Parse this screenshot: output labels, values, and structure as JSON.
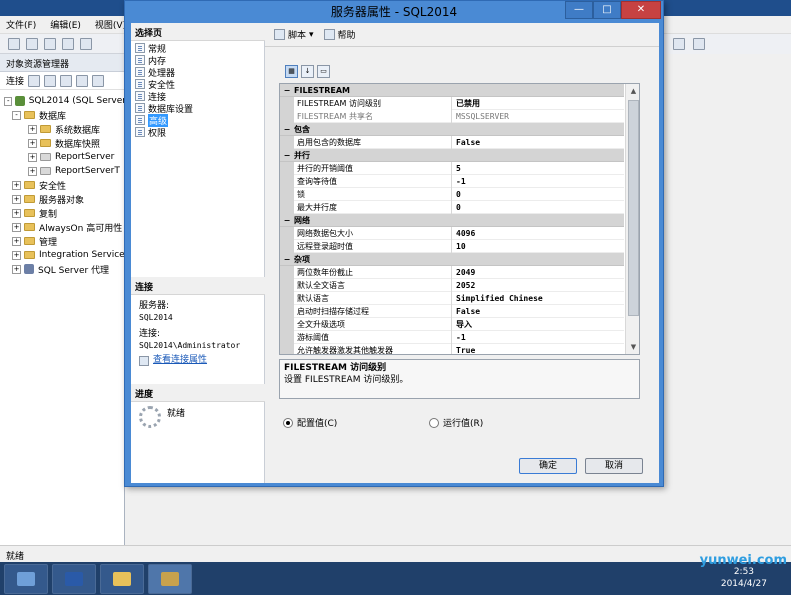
{
  "ssms": {
    "menu": [
      "文件(F)",
      "编辑(E)",
      "视图(V)"
    ],
    "explorer_title": "对象资源管理器",
    "connect_label": "连接",
    "tree": [
      {
        "label": "SQL2014 (SQL Server",
        "kind": "server",
        "expander": "-",
        "indent": 0
      },
      {
        "label": "数据库",
        "kind": "folder",
        "expander": "-",
        "indent": 1
      },
      {
        "label": "系统数据库",
        "kind": "folder",
        "expander": "+",
        "indent": 2
      },
      {
        "label": "数据库快照",
        "kind": "folder",
        "expander": "+",
        "indent": 2
      },
      {
        "label": "ReportServer",
        "kind": "db",
        "expander": "+",
        "indent": 2
      },
      {
        "label": "ReportServerT",
        "kind": "db",
        "expander": "+",
        "indent": 2
      },
      {
        "label": "安全性",
        "kind": "folder",
        "expander": "+",
        "indent": 1
      },
      {
        "label": "服务器对象",
        "kind": "folder",
        "expander": "+",
        "indent": 1
      },
      {
        "label": "复制",
        "kind": "folder",
        "expander": "+",
        "indent": 1
      },
      {
        "label": "AlwaysOn 高可用性",
        "kind": "folder",
        "expander": "+",
        "indent": 1
      },
      {
        "label": "管理",
        "kind": "folder",
        "expander": "+",
        "indent": 1
      },
      {
        "label": "Integration Service",
        "kind": "folder",
        "expander": "+",
        "indent": 1
      },
      {
        "label": "SQL Server 代理",
        "kind": "agent",
        "expander": "+",
        "indent": 1
      }
    ],
    "status": "就绪",
    "clock_time": "2:53",
    "clock_date": "2014/4/27",
    "watermark": "yunwei.com"
  },
  "dialog": {
    "title": "服务器属性 - SQL2014",
    "select_page_header": "选择页",
    "pages": [
      "常规",
      "内存",
      "处理器",
      "安全性",
      "连接",
      "数据库设置",
      "高级",
      "权限"
    ],
    "selected_page_index": 6,
    "connection_header": "连接",
    "server_label": "服务器:",
    "server_value": "SQL2014",
    "connection_label": "连接:",
    "connection_value": "SQL2014\\Administrator",
    "view_conn_props": "查看连接属性",
    "progress_header": "进度",
    "progress_status": "就绪",
    "toolbar": {
      "script": "脚本",
      "help": "帮助"
    },
    "categories": [
      {
        "name": "FILESTREAM",
        "rows": [
          {
            "name": "FILESTREAM 访问级别",
            "value": "已禁用",
            "readonly": false
          },
          {
            "name": "FILESTREAM 共享名",
            "value": "MSSQLSERVER",
            "readonly": true
          }
        ]
      },
      {
        "name": "包含",
        "rows": [
          {
            "name": "启用包含的数据库",
            "value": "False",
            "readonly": false
          }
        ]
      },
      {
        "name": "并行",
        "rows": [
          {
            "name": "并行的开销阈值",
            "value": "5",
            "readonly": false
          },
          {
            "name": "查询等待值",
            "value": "-1",
            "readonly": false
          },
          {
            "name": "锁",
            "value": "0",
            "readonly": false
          },
          {
            "name": "最大并行度",
            "value": "0",
            "readonly": false
          }
        ]
      },
      {
        "name": "网络",
        "rows": [
          {
            "name": "网络数据包大小",
            "value": "4096",
            "readonly": false
          },
          {
            "name": "远程登录超时值",
            "value": "10",
            "readonly": false
          }
        ]
      },
      {
        "name": "杂项",
        "rows": [
          {
            "name": "两位数年份截止",
            "value": "2049",
            "readonly": false
          },
          {
            "name": "默认全文语言",
            "value": "2052",
            "readonly": false
          },
          {
            "name": "默认语言",
            "value": "Simplified Chinese",
            "readonly": false
          },
          {
            "name": "启动时扫描存储过程",
            "value": "False",
            "readonly": false
          },
          {
            "name": "全文升级选项",
            "value": "导入",
            "readonly": false
          },
          {
            "name": "游标阈值",
            "value": "-1",
            "readonly": false
          },
          {
            "name": "允许触发器激发其他触发器",
            "value": "True",
            "readonly": false
          }
        ]
      }
    ],
    "description_title": "FILESTREAM 访问级别",
    "description_text": "设置 FILESTREAM 访问级别。",
    "radio_configured": "配置值(C)",
    "radio_running": "运行值(R)",
    "ok_button": "确定",
    "cancel_button": "取消"
  },
  "colors": {
    "dialog_frame": "#4a8ad4",
    "selection": "#3399ff",
    "link": "#1a59b8"
  }
}
